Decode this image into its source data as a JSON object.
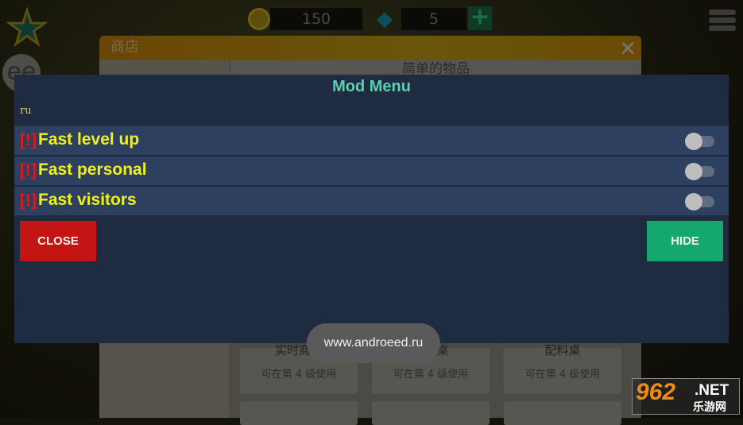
{
  "game": {
    "coins": "150",
    "gems": "5",
    "shop_title": "商店",
    "shop_close": "✕",
    "category_title": "简单的物品",
    "cards": [
      {
        "name": "实时商店",
        "requirement": "可在第 4 级使用"
      },
      {
        "name": "…长桌",
        "requirement": "可在第 4 级使用"
      },
      {
        "name": "配料桌",
        "requirement": "可在第 4 级使用"
      }
    ]
  },
  "mod_menu": {
    "title": "Mod Menu",
    "subtitle": "ru",
    "items": [
      {
        "warn": "[!]",
        "label": "Fast level up",
        "enabled": false
      },
      {
        "warn": "[!]",
        "label": "Fast personal",
        "enabled": false
      },
      {
        "warn": "[!]",
        "label": "Fast visitors",
        "enabled": false
      }
    ],
    "close_label": "CLOSE",
    "hide_label": "HIDE"
  },
  "toast": "www.androeed.ru",
  "watermark": {
    "number": "962",
    "net": ".NET",
    "chinese": "乐游网"
  },
  "colors": {
    "panel": "#1f2b40",
    "row": "#2e4060",
    "title": "#5bd0b0",
    "label": "#f0f020",
    "warn": "#e01818",
    "close": "#c41414",
    "hide": "#14a86c"
  }
}
